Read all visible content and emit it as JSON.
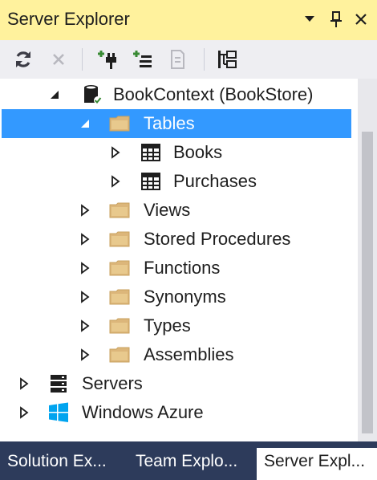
{
  "title": "Server Explorer",
  "tree": {
    "context_label": "BookContext (BookStore)",
    "tables_label": "Tables",
    "books_label": "Books",
    "purchases_label": "Purchases",
    "views_label": "Views",
    "stored_procedures_label": "Stored Procedures",
    "functions_label": "Functions",
    "synonyms_label": "Synonyms",
    "types_label": "Types",
    "assemblies_label": "Assemblies",
    "servers_label": "Servers",
    "azure_label": "Windows Azure"
  },
  "tabs": {
    "solution_explorer": "Solution Ex...",
    "team_explorer": "Team Explo...",
    "server_explorer": "Server Expl..."
  },
  "colors": {
    "titlebar": "#fff29d",
    "selection": "#3399ff",
    "folder": "#dcb67a",
    "tabbar": "#2d3b5b"
  }
}
